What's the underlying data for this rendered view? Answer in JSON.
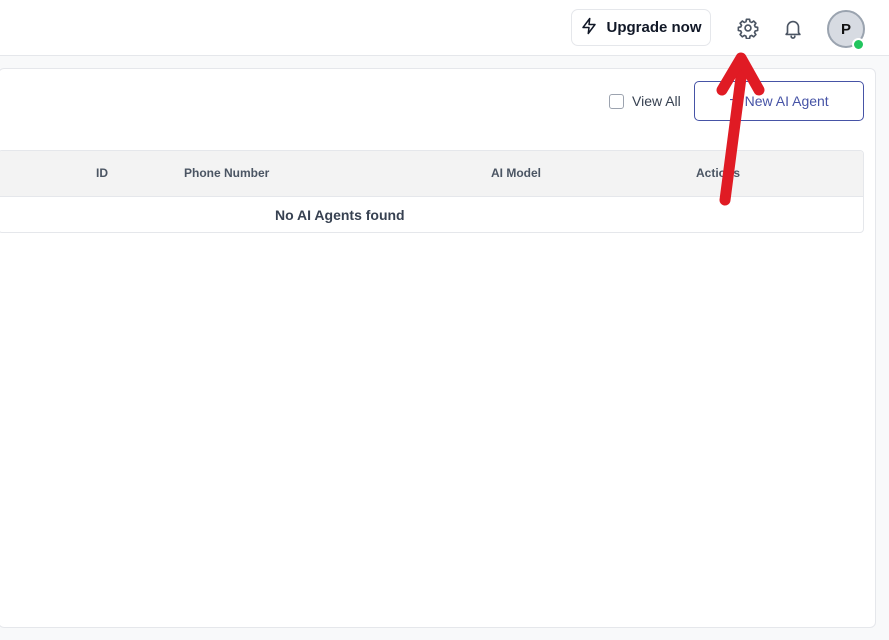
{
  "topbar": {
    "upgrade_label": "Upgrade now",
    "upgrade_icon": "lightning-bolt-icon",
    "settings_icon": "gear-icon",
    "notifications_icon": "bell-icon",
    "avatar_initial": "P",
    "status_color": "#22c55e"
  },
  "toolbar": {
    "view_all_label": "View All",
    "view_all_checked": false,
    "new_agent_label": "New AI Agent",
    "new_agent_icon": "plus-icon"
  },
  "table": {
    "columns": [
      "ID",
      "Phone Number",
      "AI Model",
      "Actions"
    ],
    "empty_message": "No AI Agents found"
  },
  "colors": {
    "accent": "#4653a6",
    "annotation_arrow": "#e01b24"
  }
}
